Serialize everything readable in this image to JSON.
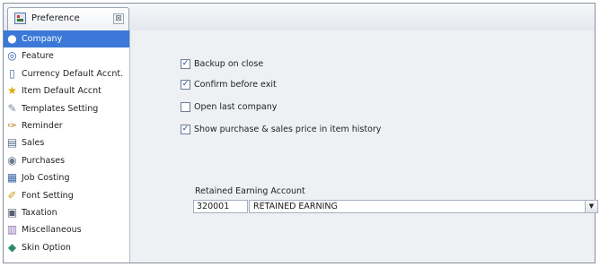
{
  "tab": {
    "title": "Preference",
    "close_glyph": "⊠"
  },
  "sidebar": {
    "items": [
      {
        "label": "Company",
        "icon": "●"
      },
      {
        "label": "Feature",
        "icon": "◎"
      },
      {
        "label": "Currency Default Accnt.",
        "icon": "▯"
      },
      {
        "label": "Item Default Accnt",
        "icon": "★"
      },
      {
        "label": "Templates Setting",
        "icon": "✎"
      },
      {
        "label": "Reminder",
        "icon": "✑"
      },
      {
        "label": "Sales",
        "icon": "▤"
      },
      {
        "label": "Purchases",
        "icon": "◉"
      },
      {
        "label": "Job Costing",
        "icon": "▦"
      },
      {
        "label": "Font Setting",
        "icon": "✐"
      },
      {
        "label": "Taxation",
        "icon": "▣"
      },
      {
        "label": "Miscellaneous",
        "icon": "▥"
      },
      {
        "label": "Skin Option",
        "icon": "◆"
      }
    ]
  },
  "options": [
    {
      "label": "Backup on close",
      "checked": true
    },
    {
      "label": "Confirm before exit",
      "checked": true
    },
    {
      "label": "Open last company",
      "checked": false
    },
    {
      "label": "Show purchase & sales price in item history",
      "checked": true
    }
  ],
  "check_glyph": "✓",
  "retained": {
    "label": "Retained Earning Account",
    "code": "320001",
    "account": "RETAINED EARNING",
    "dropdown_glyph": "▼"
  }
}
